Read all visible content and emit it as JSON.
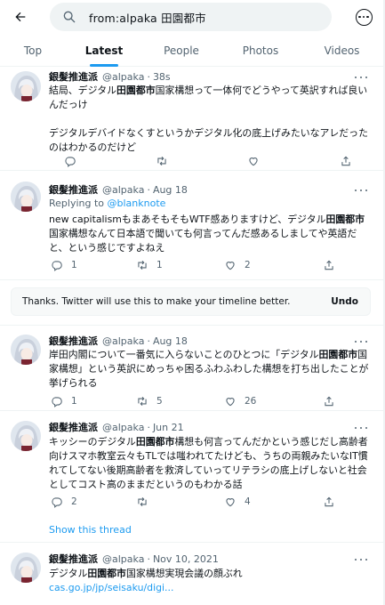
{
  "header": {
    "search_query": "from:alpaka 田園都市"
  },
  "tabs": [
    {
      "label": "Top"
    },
    {
      "label": "Latest"
    },
    {
      "label": "People"
    },
    {
      "label": "Photos"
    },
    {
      "label": "Videos"
    }
  ],
  "active_tab": "Latest",
  "tweets": [
    {
      "name": "銀髪推進派",
      "handle": "@alpaka",
      "sep": "·",
      "time": "38s",
      "text_parts": [
        "結局、デジタル",
        "田園都市",
        "国家構想って一体何でどうやって英訳すれば良いんだっけ\n\nデジタルデバイドなくすというかデジタル化の底上げみたいなアレだったのはわかるのだけど"
      ],
      "counts": {
        "reply": "",
        "retweet": "",
        "like": ""
      }
    },
    {
      "name": "銀髪推進派",
      "handle": "@alpaka",
      "sep": "·",
      "time": "Aug 18",
      "reply_prefix": "Replying to ",
      "reply_to": "@blanknote",
      "text_parts": [
        "new capitalismもまあそもそもWTF感ありますけど、デジタル",
        "田園都市",
        "国家構想なんて日本語で聞いても何言ってんだ感あるしましてや英語だと、という感じですよねえ"
      ],
      "counts": {
        "reply": "1",
        "retweet": "1",
        "like": "2"
      }
    },
    {
      "name": "銀髪推進派",
      "handle": "@alpaka",
      "sep": "·",
      "time": "Aug 18",
      "text_parts": [
        "岸田内閣について一番気に入らないことのひとつに「デジタル",
        "田園都市",
        "国家構想」という英訳にめっちゃ困るふわふわした構想を打ち出したことが挙げられる"
      ],
      "counts": {
        "reply": "1",
        "retweet": "5",
        "like": "26"
      }
    },
    {
      "name": "銀髪推進派",
      "handle": "@alpaka",
      "sep": "·",
      "time": "Jun 21",
      "text_parts": [
        "キッシーのデジタル",
        "田園都市",
        "構想も何言ってんだかという感じだし高齢者向けスマホ教室云々もTLでは嗤われてたけども、うちの両親みたいなIT慣れてしてない後期高齢者を救済していってリテラシの底上げしないと社会としてコスト高のままだというのもわかる話"
      ],
      "counts": {
        "reply": "2",
        "retweet": "",
        "like": "4"
      }
    },
    {
      "name": "銀髪推進派",
      "handle": "@alpaka",
      "sep": "·",
      "time": "Nov 10, 2021",
      "text_parts": [
        "デジタル",
        "田園都市",
        "国家構想実現会議の顔ぶれ"
      ],
      "link": "cas.go.jp/jp/seisaku/digi..."
    }
  ],
  "notice": {
    "message": "Thanks. Twitter will use this to make your timeline better.",
    "undo": "Undo"
  },
  "show_thread": "Show this thread"
}
